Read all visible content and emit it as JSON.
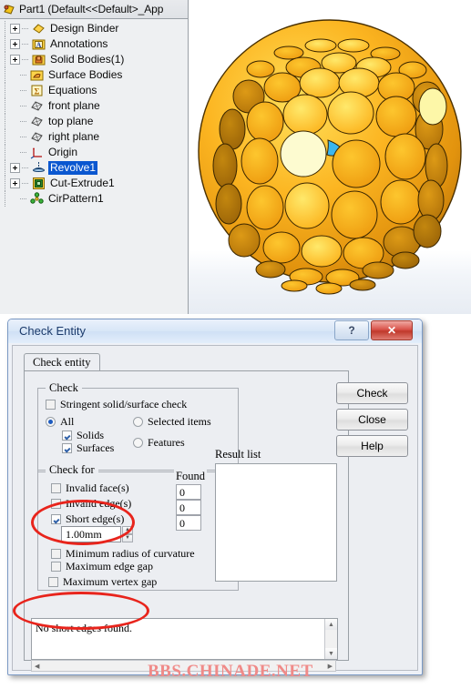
{
  "tree": {
    "title": "Part1  (Default<<Default>_App",
    "title_icon": "part-document-icon",
    "items": [
      {
        "label": "Design Binder",
        "icon": "design-binder-icon",
        "expandable": true,
        "selected": false
      },
      {
        "label": "Annotations",
        "icon": "annotations-folder-icon",
        "expandable": true,
        "selected": false
      },
      {
        "label": "Solid Bodies(1)",
        "icon": "solid-bodies-folder-icon",
        "expandable": true,
        "selected": false
      },
      {
        "label": "Surface Bodies",
        "icon": "surface-bodies-folder-icon",
        "expandable": false,
        "selected": false
      },
      {
        "label": "Equations",
        "icon": "equations-icon",
        "expandable": false,
        "selected": false
      },
      {
        "label": "front plane",
        "icon": "plane-icon",
        "expandable": false,
        "selected": false
      },
      {
        "label": "top plane",
        "icon": "plane-icon",
        "expandable": false,
        "selected": false
      },
      {
        "label": "right plane",
        "icon": "plane-icon",
        "expandable": false,
        "selected": false
      },
      {
        "label": "Origin",
        "icon": "origin-icon",
        "expandable": false,
        "selected": false
      },
      {
        "label": "Revolve1",
        "icon": "revolve-feature-icon",
        "expandable": true,
        "selected": true
      },
      {
        "label": "Cut-Extrude1",
        "icon": "cut-extrude-icon",
        "expandable": true,
        "selected": false
      },
      {
        "label": "CirPattern1",
        "icon": "circular-pattern-icon",
        "expandable": false,
        "selected": false
      }
    ]
  },
  "viewport": {
    "model_name": "golf-ball-model",
    "body_color": "#f5a623",
    "highlight_face_color": "#fdfbd0",
    "selected_face_color": "#3cb6ef"
  },
  "dialog": {
    "title": "Check Entity",
    "help_button_glyph": "?",
    "close_button_glyph": "✕",
    "tab_label": "Check entity",
    "check_group": {
      "title": "Check",
      "stringent": {
        "label": "Stringent solid/surface check",
        "checked": false
      },
      "all": {
        "label": "All",
        "checked": true
      },
      "solids": {
        "label": "Solids",
        "checked": true
      },
      "surfaces": {
        "label": "Surfaces",
        "checked": true
      },
      "selected_items": {
        "label": "Selected items",
        "checked": false
      },
      "features": {
        "label": "Features",
        "checked": false
      }
    },
    "check_for_group": {
      "title": "Check for",
      "found_header": "Found",
      "rows": [
        {
          "label": "Invalid face(s)",
          "checked": false,
          "found": "0"
        },
        {
          "label": "Invalid edge(s)",
          "checked": false,
          "found": "0"
        },
        {
          "label": "Short edge(s)",
          "checked": true,
          "found": "0"
        }
      ],
      "short_edge_value": "1.00mm",
      "spin_up": "▲",
      "spin_down": "▼",
      "extra_rows": [
        {
          "label": "Minimum radius of curvature",
          "checked": false
        },
        {
          "label": "Maximum edge gap",
          "checked": false
        },
        {
          "label": "Maximum vertex gap",
          "checked": false
        }
      ]
    },
    "result_list": {
      "label": "Result list",
      "items": []
    },
    "message": "No short edges found.",
    "scroll_up_glyph": "▲",
    "scroll_down_glyph": "▼",
    "scroll_left_glyph": "◀",
    "scroll_right_glyph": "▶",
    "buttons": {
      "check": "Check",
      "close": "Close",
      "help": "Help"
    }
  },
  "annotations": {
    "color": "#e8241c",
    "ellipse_short_edge": "short-edge-option",
    "ellipse_message": "no-short-edges-message"
  },
  "watermark": "BBS.CHINADE.NET"
}
